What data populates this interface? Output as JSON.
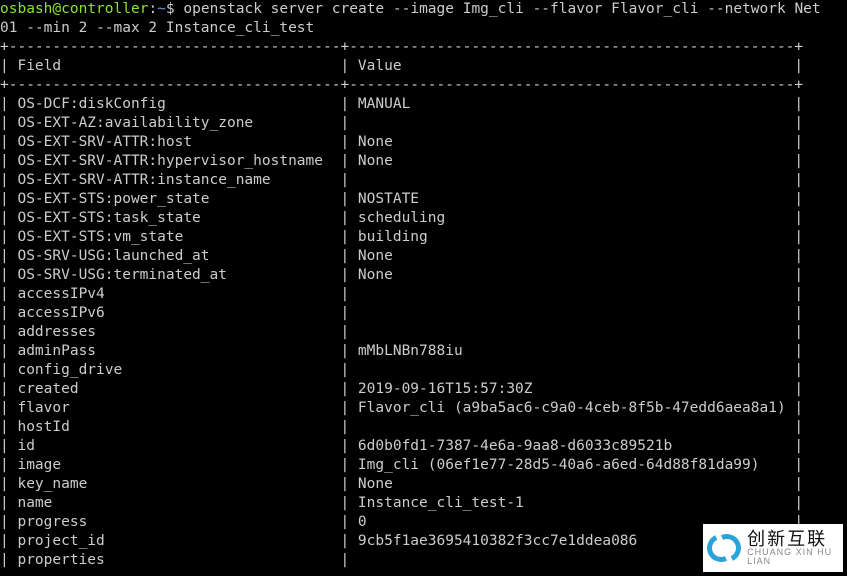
{
  "prompt": {
    "user": "osbash",
    "at": "@",
    "host": "controller",
    "colon": ":",
    "path": "~",
    "dollar": "$ "
  },
  "command_line_1": "openstack server create --image Img_cli --flavor Flavor_cli --network Net",
  "command_line_2": "01 --min 2 --max 2 Instance_cli_test",
  "header": {
    "field": "Field",
    "value": "Value"
  },
  "rows": [
    {
      "field": "OS-DCF:diskConfig",
      "value": "MANUAL"
    },
    {
      "field": "OS-EXT-AZ:availability_zone",
      "value": ""
    },
    {
      "field": "OS-EXT-SRV-ATTR:host",
      "value": "None"
    },
    {
      "field": "OS-EXT-SRV-ATTR:hypervisor_hostname",
      "value": "None"
    },
    {
      "field": "OS-EXT-SRV-ATTR:instance_name",
      "value": ""
    },
    {
      "field": "OS-EXT-STS:power_state",
      "value": "NOSTATE"
    },
    {
      "field": "OS-EXT-STS:task_state",
      "value": "scheduling"
    },
    {
      "field": "OS-EXT-STS:vm_state",
      "value": "building"
    },
    {
      "field": "OS-SRV-USG:launched_at",
      "value": "None"
    },
    {
      "field": "OS-SRV-USG:terminated_at",
      "value": "None"
    },
    {
      "field": "accessIPv4",
      "value": ""
    },
    {
      "field": "accessIPv6",
      "value": ""
    },
    {
      "field": "addresses",
      "value": ""
    },
    {
      "field": "adminPass",
      "value": "mMbLNBn788iu"
    },
    {
      "field": "config_drive",
      "value": ""
    },
    {
      "field": "created",
      "value": "2019-09-16T15:57:30Z"
    },
    {
      "field": "flavor",
      "value": "Flavor_cli (a9ba5ac6-c9a0-4ceb-8f5b-47edd6aea8a1)"
    },
    {
      "field": "hostId",
      "value": ""
    },
    {
      "field": "id",
      "value": "6d0b0fd1-7387-4e6a-9aa8-d6033c89521b"
    },
    {
      "field": "image",
      "value": "Img_cli (06ef1e77-28d5-40a6-a6ed-64d88f81da99)"
    },
    {
      "field": "key_name",
      "value": "None"
    },
    {
      "field": "name",
      "value": "Instance_cli_test-1"
    },
    {
      "field": "progress",
      "value": "0"
    },
    {
      "field": "project_id",
      "value": "9cb5f1ae3695410382f3cc7e1ddea086"
    },
    {
      "field": "properties",
      "value": ""
    }
  ],
  "col_widths": {
    "field": 38,
    "value": 51
  },
  "logo": {
    "cn": "创新互联",
    "en": "CHUANG XIN HU LIAN"
  }
}
